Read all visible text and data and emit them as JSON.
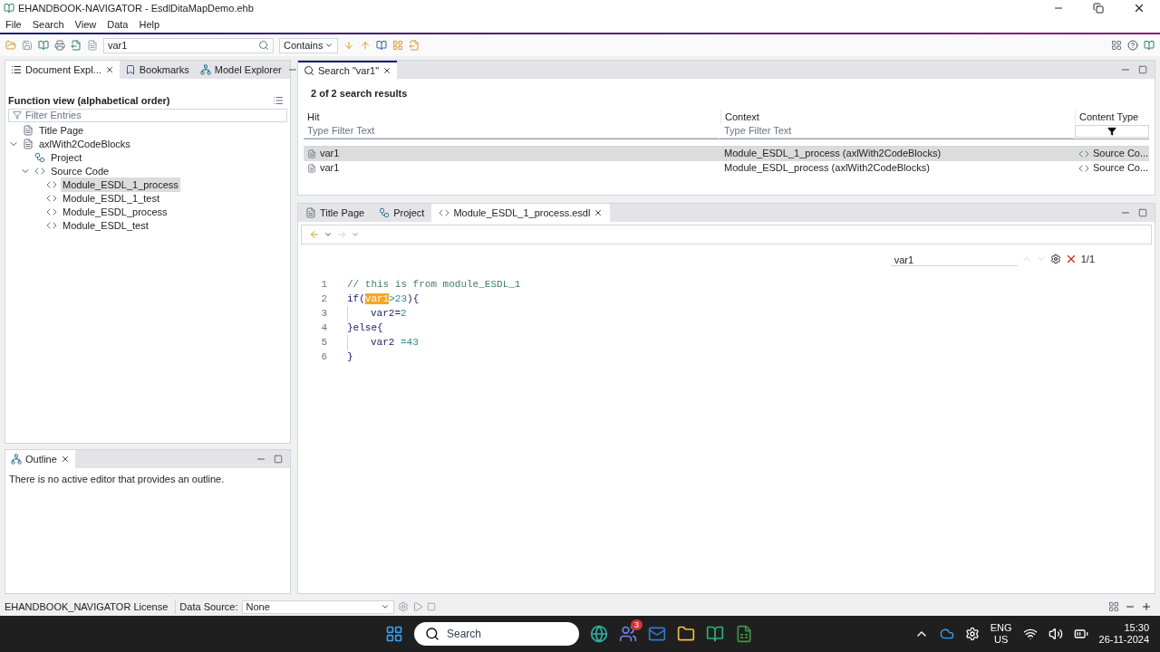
{
  "window": {
    "title": "EHANDBOOK-NAVIGATOR - EsdlDitaMapDemo.ehb"
  },
  "menu": [
    "File",
    "Search",
    "View",
    "Data",
    "Help"
  ],
  "toolbar": {
    "search_value": "var1",
    "match_mode": "Contains"
  },
  "left_tabs": [
    {
      "label": "Document Expl...",
      "selected": true,
      "closable": true
    },
    {
      "label": "Bookmarks",
      "selected": false,
      "closable": false
    },
    {
      "label": "Model Explorer",
      "selected": false,
      "closable": false
    }
  ],
  "function_view": {
    "heading": "Function view (alphabetical order)",
    "filter_placeholder": "Filter Entries",
    "tree": [
      {
        "label": "Title Page",
        "kind": "page",
        "selected": false
      },
      {
        "label": "axlWith2CodeBlocks",
        "kind": "page",
        "selected": false,
        "expanded": true,
        "children": [
          {
            "label": "Project",
            "kind": "project",
            "selected": false
          },
          {
            "label": "Source Code",
            "kind": "code",
            "selected": false,
            "expanded": true,
            "children": [
              {
                "label": "Module_ESDL_1_process",
                "kind": "code",
                "selected": true
              },
              {
                "label": "Module_ESDL_1_test",
                "kind": "code",
                "selected": false
              },
              {
                "label": "Module_ESDL_process",
                "kind": "code",
                "selected": false
              },
              {
                "label": "Module_ESDL_test",
                "kind": "code",
                "selected": false
              }
            ]
          }
        ]
      }
    ]
  },
  "outline": {
    "tab": "Outline",
    "message": "There is no active editor that provides an outline."
  },
  "search": {
    "tab": "Search \"var1\"",
    "summary": "2 of 2 search results",
    "columns": [
      "Hit",
      "Context",
      "Content Type"
    ],
    "filter_placeholders": [
      "Type Filter Text",
      "Type Filter Text"
    ],
    "rows": [
      {
        "hit": "var1",
        "context": "Module_ESDL_1_process (axlWith2CodeBlocks)",
        "type": "Source Co...",
        "selected": true
      },
      {
        "hit": "var1",
        "context": "Module_ESDL_process (axlWith2CodeBlocks)",
        "type": "Source Co...",
        "selected": false
      }
    ]
  },
  "editor": {
    "tabs": [
      {
        "label": "Title Page",
        "kind": "page",
        "selected": false,
        "closable": false
      },
      {
        "label": "Project",
        "kind": "project",
        "selected": false,
        "closable": false
      },
      {
        "label": "Module_ESDL_1_process.esdl",
        "kind": "code",
        "selected": true,
        "closable": true
      }
    ],
    "find": {
      "value": "var1",
      "count": "1/1"
    },
    "lines": [
      {
        "number": "1",
        "indented": false,
        "segments": [
          {
            "text": "// this is from module_ESDL_1",
            "kind": "comment"
          }
        ]
      },
      {
        "number": "2",
        "indented": false,
        "segments": [
          {
            "text": "if(",
            "kind": "plain"
          },
          {
            "text": "var1",
            "kind": "match"
          },
          {
            "text": ">23",
            "kind": "number"
          },
          {
            "text": "){",
            "kind": "plain"
          }
        ]
      },
      {
        "number": "3",
        "indented": true,
        "segments": [
          {
            "text": "var2=",
            "kind": "plain"
          },
          {
            "text": "2",
            "kind": "number"
          }
        ]
      },
      {
        "number": "4",
        "indented": false,
        "segments": [
          {
            "text": "}else{",
            "kind": "plain"
          }
        ]
      },
      {
        "number": "5",
        "indented": true,
        "segments": [
          {
            "text": "var2 ",
            "kind": "plain"
          },
          {
            "text": "=43",
            "kind": "number"
          }
        ]
      },
      {
        "number": "6",
        "indented": false,
        "segments": [
          {
            "text": "}",
            "kind": "plain"
          }
        ]
      }
    ]
  },
  "status_bar": {
    "license": "EHANDBOOK_NAVIGATOR License",
    "data_source_label": "Data Source:",
    "data_source": "None"
  },
  "taskbar": {
    "search_placeholder": "Search",
    "badge": "3",
    "language": "ENG",
    "region": "US",
    "time": "15:30",
    "date": "26-11-2024"
  }
}
